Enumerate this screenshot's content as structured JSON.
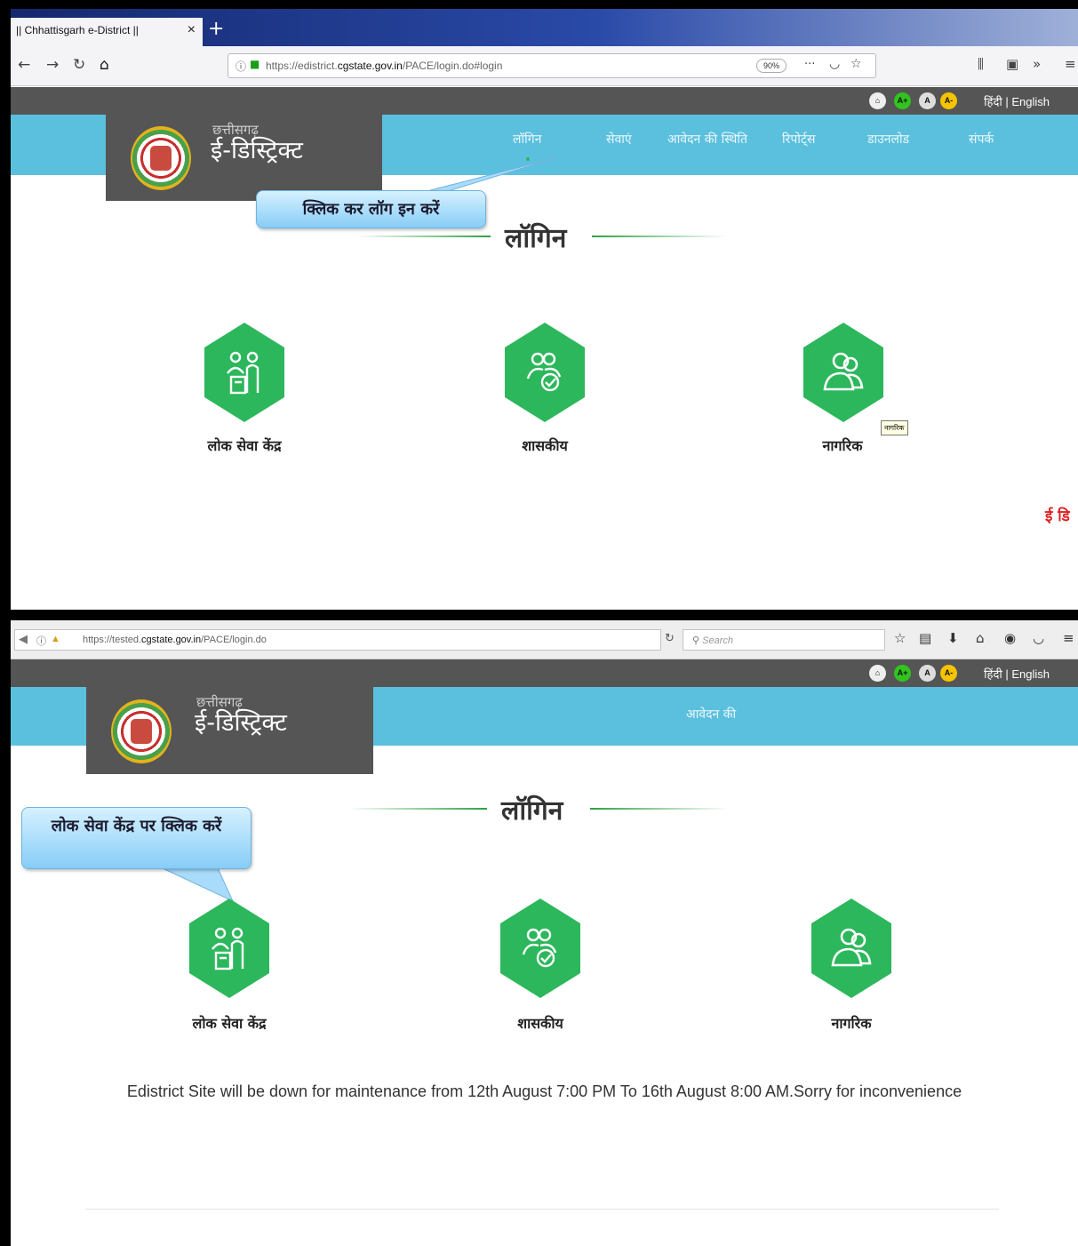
{
  "panel1": {
    "browser": {
      "tab_title": "|| Chhattisgarh e-District ||",
      "tab_close": "×",
      "new_tab": "+",
      "url_prefix": "https://edistrict.",
      "url_domain": "cgstate.gov.in",
      "url_path": "/PACE/login.do#login",
      "zoom": "90%"
    },
    "menu": [
      "लॉगिन",
      "सेवाएं",
      "आवेदन की स्थिति",
      "रिपोर्ट्स",
      "डाउनलोड",
      "संपर्क"
    ],
    "callout": "क्लिक कर लॉग इन करें",
    "tooltip": "नागरिक",
    "marquee_fragment": "ई डि"
  },
  "panel2": {
    "browser": {
      "url_prefix": "https://tested.",
      "url_domain": "cgstate.gov.in",
      "url_path": "/PACE/login.do",
      "search_placeholder": "Search"
    },
    "menu_visible": "आवेदन की",
    "callout": "लोक सेवा केंद्र पर क्लिक करें",
    "notice": "Edistrict Site will be down for maintenance from 12th August 7:00 PM To 16th August 8:00 AM.Sorry for inconvenience"
  },
  "site": {
    "brand_small": "छत्तीसगढ़",
    "brand_big": "ई-डिस्ट्रिक्ट",
    "accessibility": [
      "A+",
      "A",
      "A-"
    ],
    "lang_hindi": "हिंदी",
    "lang_sep": "|",
    "lang_english": "English",
    "login_heading": "लॉगिन",
    "roles": [
      "लोक सेवा केंद्र",
      "शासकीय",
      "नागरिक"
    ]
  },
  "colors": {
    "header_blue": "#5bc0de",
    "header_dark": "#555555",
    "role_green": "#2db75c",
    "callout_blue": "#87cdf7",
    "alert_red": "#e02020"
  }
}
